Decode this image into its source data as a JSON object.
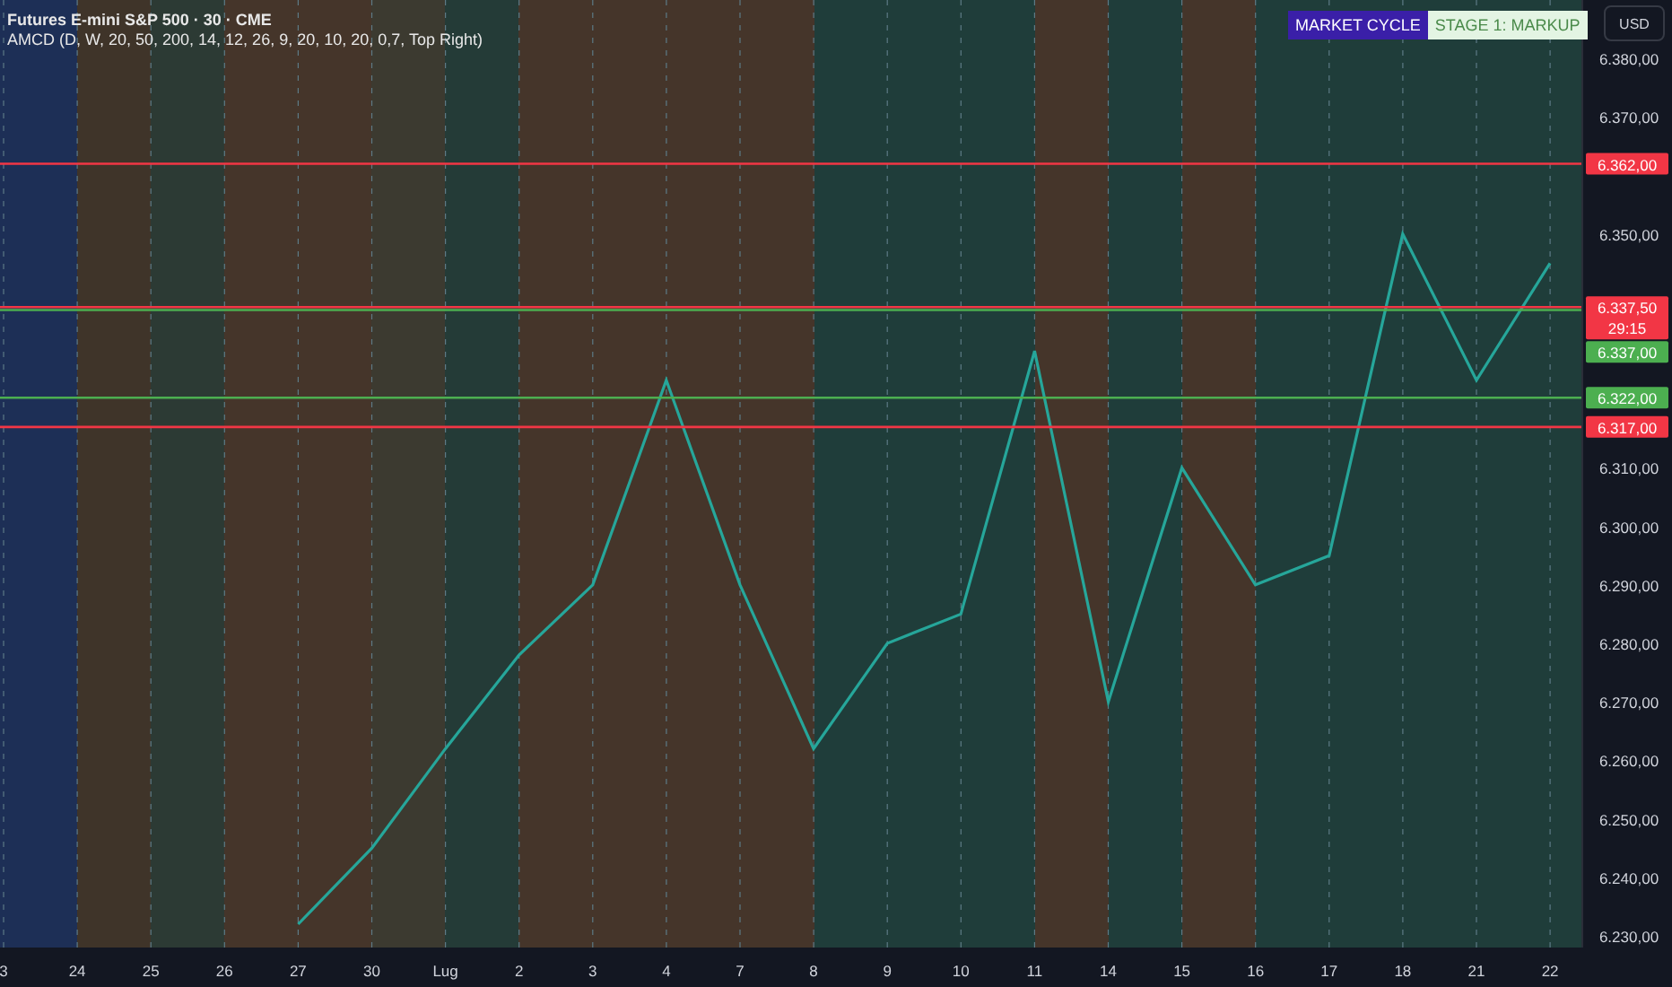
{
  "header": {
    "symbol_title": "Futures E-mini S&P 500 · 30 · CME",
    "indicator": "AMCD (D, W, 20, 50, 200, 14, 12, 26, 9, 20, 10, 20, 0,7, Top Right)"
  },
  "market_cycle": {
    "label": "MARKET CYCLE",
    "stage": "STAGE 1: MARKUP"
  },
  "currency_button": "USD",
  "countdown": "29:15",
  "background_bands": [
    {
      "color": "#1d2f56"
    },
    {
      "color": "#3f3429"
    },
    {
      "color": "#2c3a34"
    },
    {
      "color": "#45352a"
    },
    {
      "color": "#45352a"
    },
    {
      "color": "#3c3a30"
    },
    {
      "color": "#243b37"
    },
    {
      "color": "#45352a"
    },
    {
      "color": "#45352a"
    },
    {
      "color": "#45352a"
    },
    {
      "color": "#45352a"
    },
    {
      "color": "#1f3d3a"
    },
    {
      "color": "#1f3d3a"
    },
    {
      "color": "#1f3d3a"
    },
    {
      "color": "#45352a"
    },
    {
      "color": "#1f3d3a"
    },
    {
      "color": "#45352a"
    },
    {
      "color": "#1f3d3a"
    },
    {
      "color": "#1f3d3a"
    },
    {
      "color": "#1f3d3a"
    },
    {
      "color": "#1f3d3a"
    },
    {
      "color": "#1f3d3a"
    }
  ],
  "chart_data": {
    "type": "line",
    "grid": true,
    "categories": [
      "3",
      "24",
      "25",
      "26",
      "27",
      "30",
      "Lug",
      "2",
      "3",
      "4",
      "7",
      "8",
      "9",
      "10",
      "11",
      "14",
      "15",
      "16",
      "17",
      "18",
      "21",
      "22"
    ],
    "series": [
      {
        "color": "#26a69a",
        "values": [
          null,
          null,
          null,
          null,
          6232,
          6245,
          6262,
          6278,
          6290,
          6325,
          6290,
          6262,
          6280,
          6285,
          6330,
          6270,
          6310,
          6290,
          6295,
          6350,
          6325,
          6345
        ]
      }
    ],
    "ylim": [
      6228,
      6390
    ],
    "yticks": [
      {
        "value": 6380,
        "label": "6.380,00"
      },
      {
        "value": 6370,
        "label": "6.370,00"
      },
      {
        "value": 6350,
        "label": "6.350,00"
      },
      {
        "value": 6310,
        "label": "6.310,00"
      },
      {
        "value": 6300,
        "label": "6.300,00"
      },
      {
        "value": 6290,
        "label": "6.290,00"
      },
      {
        "value": 6280,
        "label": "6.280,00"
      },
      {
        "value": 6270,
        "label": "6.270,00"
      },
      {
        "value": 6260,
        "label": "6.260,00"
      },
      {
        "value": 6250,
        "label": "6.250,00"
      },
      {
        "value": 6240,
        "label": "6.240,00"
      },
      {
        "value": 6230,
        "label": "6.230,00"
      }
    ],
    "ref_lines": [
      {
        "axis": "y",
        "value": 6362,
        "label": "6.362,00",
        "color": "#f23645"
      },
      {
        "axis": "y",
        "value": 6337.5,
        "label": "6.337,50",
        "color": "#f23645"
      },
      {
        "axis": "y",
        "value": 6337,
        "label": "6.337,00",
        "color": "#4caf50"
      },
      {
        "axis": "y",
        "value": 6322,
        "label": "6.322,00",
        "color": "#4caf50"
      },
      {
        "axis": "y",
        "value": 6317,
        "label": "6.317,00",
        "color": "#f23645"
      }
    ]
  }
}
